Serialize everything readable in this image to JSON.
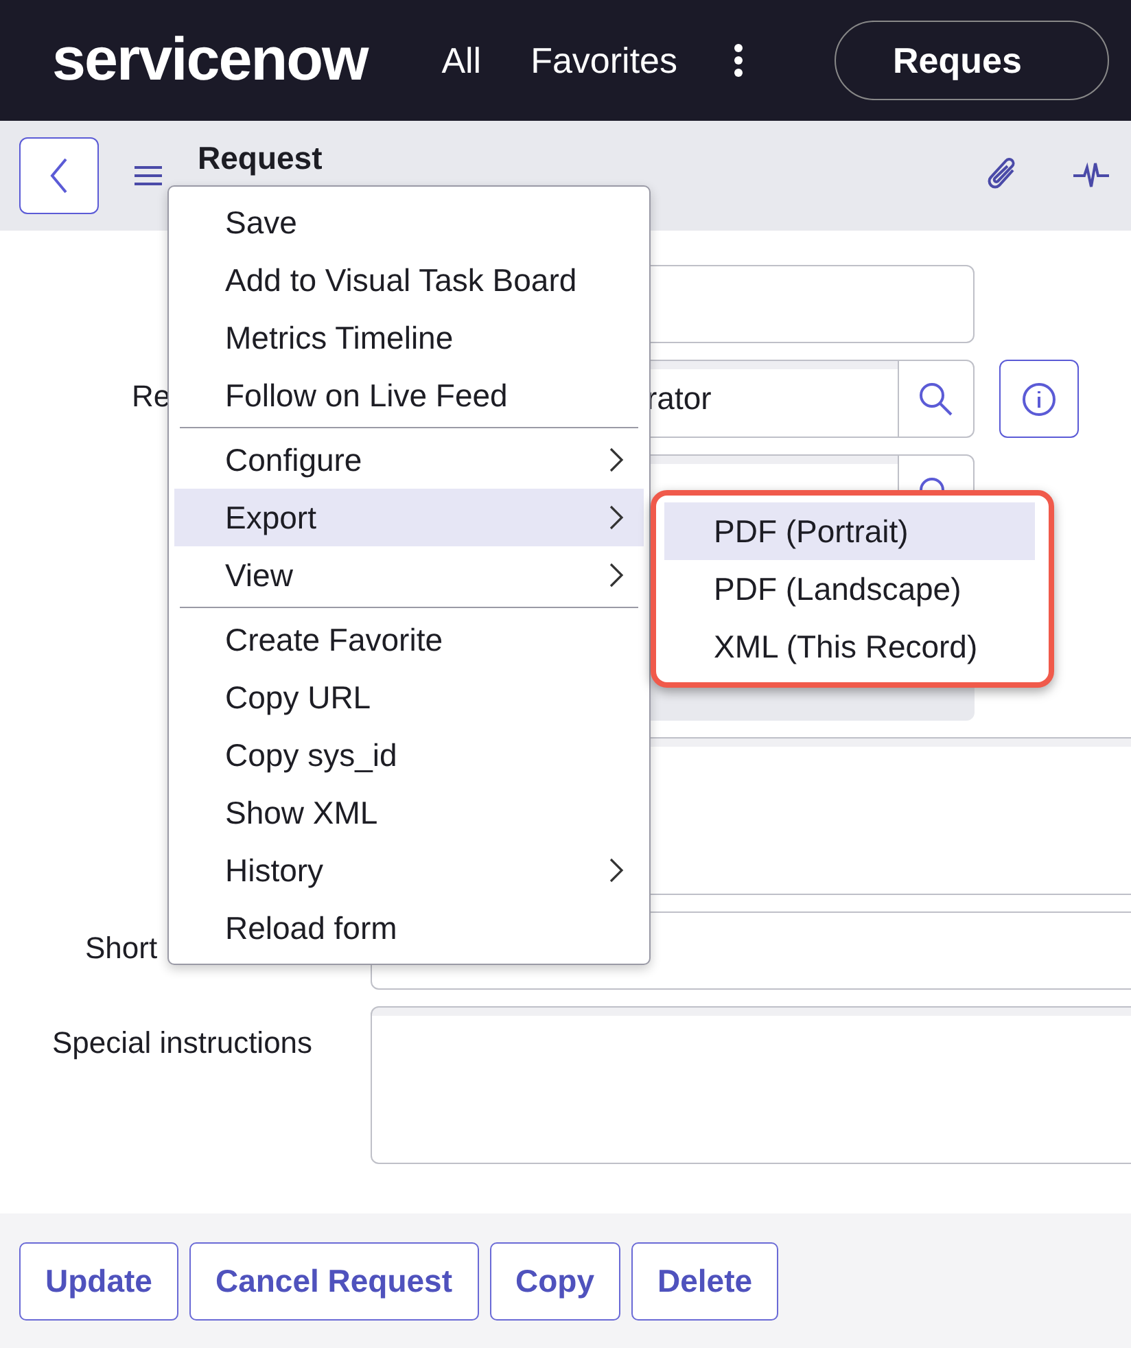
{
  "header": {
    "logo": "servicenow",
    "nav": [
      "All",
      "Favorites"
    ],
    "search_pill": "Reques"
  },
  "toolbar": {
    "title": "Request"
  },
  "form": {
    "rows": [
      {
        "kind": "field"
      },
      {
        "kind": "lookup",
        "label": "Re",
        "value": "rator",
        "info": true
      },
      {
        "kind": "lookup"
      },
      {
        "kind": "readonly"
      },
      {
        "kind": "textarea"
      },
      {
        "kind": "field",
        "label": "Short"
      },
      {
        "kind": "textarea",
        "label": "Special instructions"
      }
    ]
  },
  "context_menu": {
    "items": [
      {
        "kind": "item",
        "label": "Save",
        "submenu": false,
        "selected": false
      },
      {
        "kind": "item",
        "label": "Add to Visual Task Board",
        "submenu": false,
        "selected": false
      },
      {
        "kind": "item",
        "label": "Metrics Timeline",
        "submenu": false,
        "selected": false
      },
      {
        "kind": "item",
        "label": "Follow on Live Feed",
        "submenu": false,
        "selected": false
      },
      {
        "kind": "divider"
      },
      {
        "kind": "item",
        "label": "Configure",
        "submenu": true,
        "selected": false
      },
      {
        "kind": "item",
        "label": "Export",
        "submenu": true,
        "selected": true
      },
      {
        "kind": "item",
        "label": "View",
        "submenu": true,
        "selected": false
      },
      {
        "kind": "divider"
      },
      {
        "kind": "item",
        "label": "Create Favorite",
        "submenu": false,
        "selected": false
      },
      {
        "kind": "item",
        "label": "Copy URL",
        "submenu": false,
        "selected": false
      },
      {
        "kind": "item",
        "label": "Copy sys_id",
        "submenu": false,
        "selected": false
      },
      {
        "kind": "item",
        "label": "Show XML",
        "submenu": false,
        "selected": false
      },
      {
        "kind": "item",
        "label": "History",
        "submenu": true,
        "selected": false
      },
      {
        "kind": "item",
        "label": "Reload form",
        "submenu": false,
        "selected": false
      }
    ]
  },
  "export_submenu": {
    "highlighted": true,
    "items": [
      {
        "label": "PDF (Portrait)",
        "selected": true
      },
      {
        "label": "PDF (Landscape)",
        "selected": false
      },
      {
        "label": "XML (This Record)",
        "selected": false
      }
    ]
  },
  "buttons": [
    "Update",
    "Cancel Request",
    "Copy",
    "Delete"
  ]
}
